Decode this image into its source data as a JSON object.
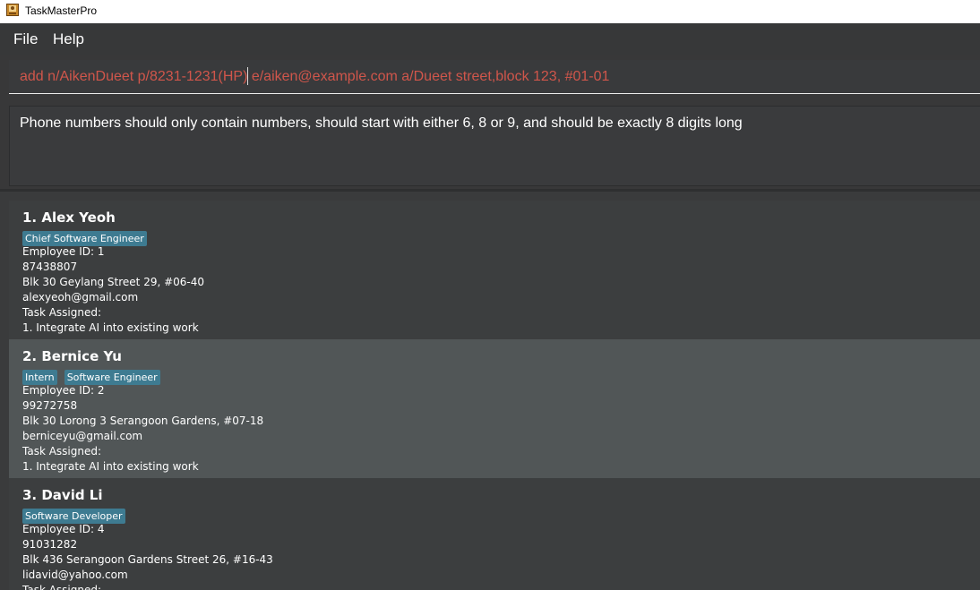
{
  "window": {
    "title": "TaskMasterPro",
    "icon": "app-icon"
  },
  "menu": {
    "file": "File",
    "help": "Help"
  },
  "command": {
    "value": "add n/AikenDueet p/8231-1231(HP) e/aiken@example.com a/Dueet street,block 123, #01-01",
    "text_color": "#d0564b"
  },
  "result": {
    "message": "Phone numbers should only contain numbers, should start with either 6, 8 or 9, and should be exactly 8 digits long"
  },
  "colors": {
    "tag": "#3e7b91",
    "selected_card": "#515657",
    "card": "#3c3e3f"
  },
  "persons": [
    {
      "title": "1.  Alex Yeoh",
      "tags": [
        "Chief Software Engineer"
      ],
      "employee_id": "Employee ID: 1",
      "phone": "87438807",
      "address": "Blk 30 Geylang Street 29, #06-40",
      "email": "alexyeoh@gmail.com",
      "task_header": "Task Assigned:",
      "task": "1. Integrate AI into existing work"
    },
    {
      "title": "2.  Bernice Yu",
      "tags": [
        "Intern",
        "Software Engineer"
      ],
      "employee_id": "Employee ID: 2",
      "phone": "99272758",
      "address": "Blk 30 Lorong 3 Serangoon Gardens, #07-18",
      "email": "berniceyu@gmail.com",
      "task_header": "Task Assigned:",
      "task": "1. Integrate AI into existing work"
    },
    {
      "title": "3.  David Li",
      "tags": [
        "Software Developer"
      ],
      "employee_id": "Employee ID: 4",
      "phone": "91031282",
      "address": "Blk 436 Serangoon Gardens Street 26, #16-43",
      "email": "lidavid@yahoo.com",
      "task_header": "Task Assigned:",
      "task": ""
    }
  ]
}
